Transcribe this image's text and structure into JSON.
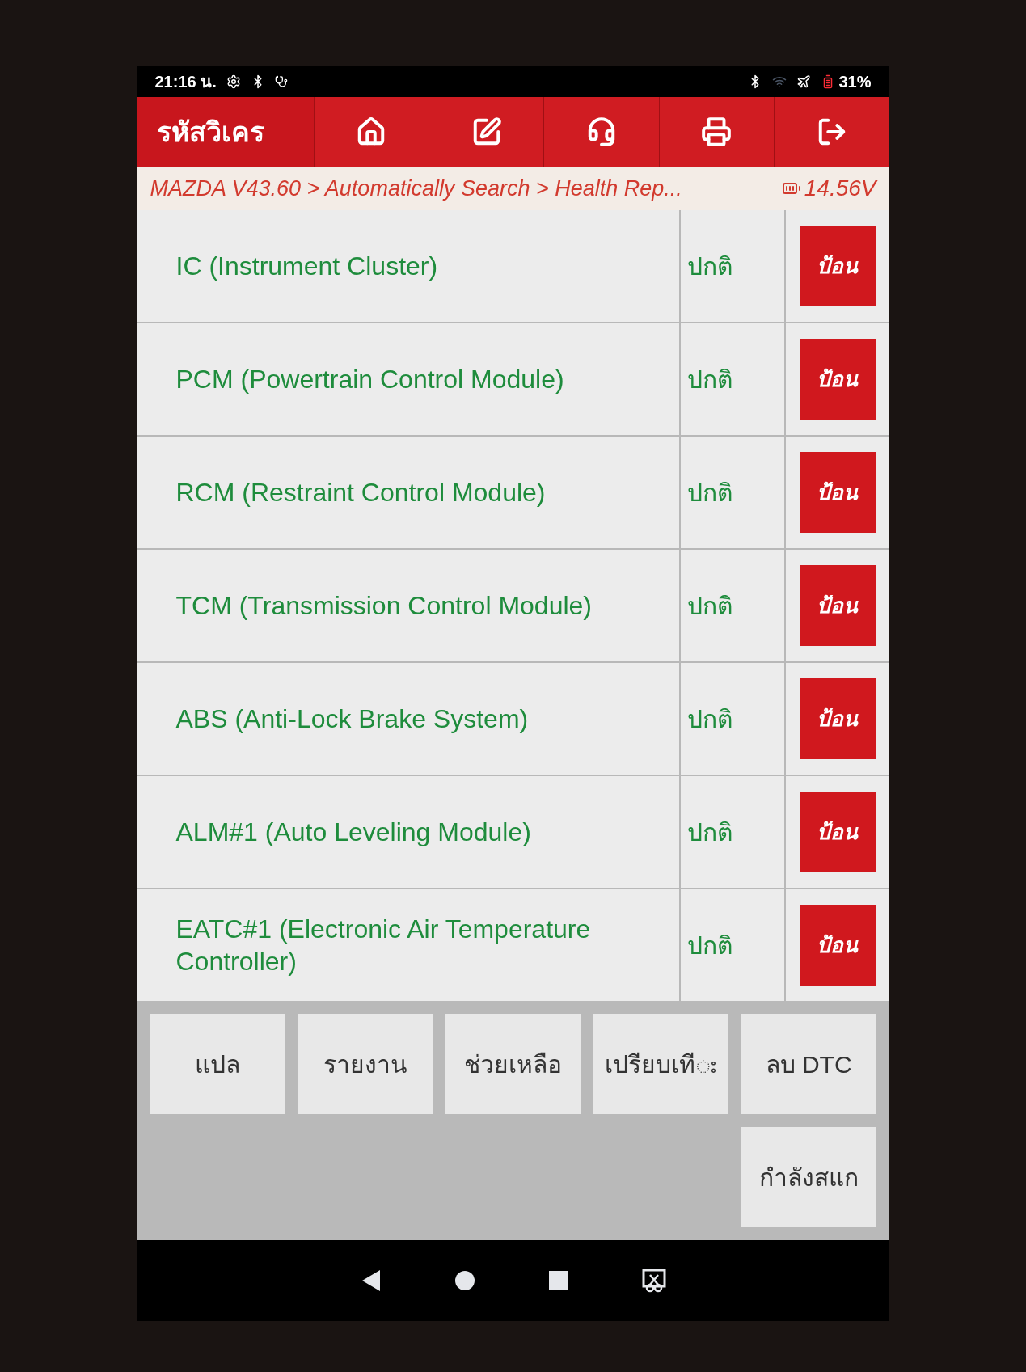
{
  "status_bar": {
    "time": "21:16 น.",
    "battery": "31%"
  },
  "header": {
    "title": "รหัสวิเคร"
  },
  "breadcrumb": {
    "path": "MAZDA V43.60 > Automatically Search > Health Rep...",
    "voltage": "14.56V"
  },
  "modules": [
    {
      "name": "IC (Instrument Cluster)",
      "status": "ปกติ",
      "action": "ป้อน"
    },
    {
      "name": "PCM (Powertrain Control Module)",
      "status": "ปกติ",
      "action": "ป้อน"
    },
    {
      "name": "RCM (Restraint Control Module)",
      "status": "ปกติ",
      "action": "ป้อน"
    },
    {
      "name": "TCM (Transmission Control Module)",
      "status": "ปกติ",
      "action": "ป้อน"
    },
    {
      "name": "ABS (Anti-Lock Brake System)",
      "status": "ปกติ",
      "action": "ป้อน"
    },
    {
      "name": "ALM#1 (Auto Leveling Module)",
      "status": "ปกติ",
      "action": "ป้อน"
    },
    {
      "name": "EATC#1 (Electronic Air Temperature Controller)",
      "status": "ปกติ",
      "action": "ป้อน"
    }
  ],
  "actions": [
    "แปล",
    "รายงาน",
    "ช่วยเหลือ",
    "เปรียบเทีး",
    "ลบ DTC",
    "กำลังสแก"
  ]
}
